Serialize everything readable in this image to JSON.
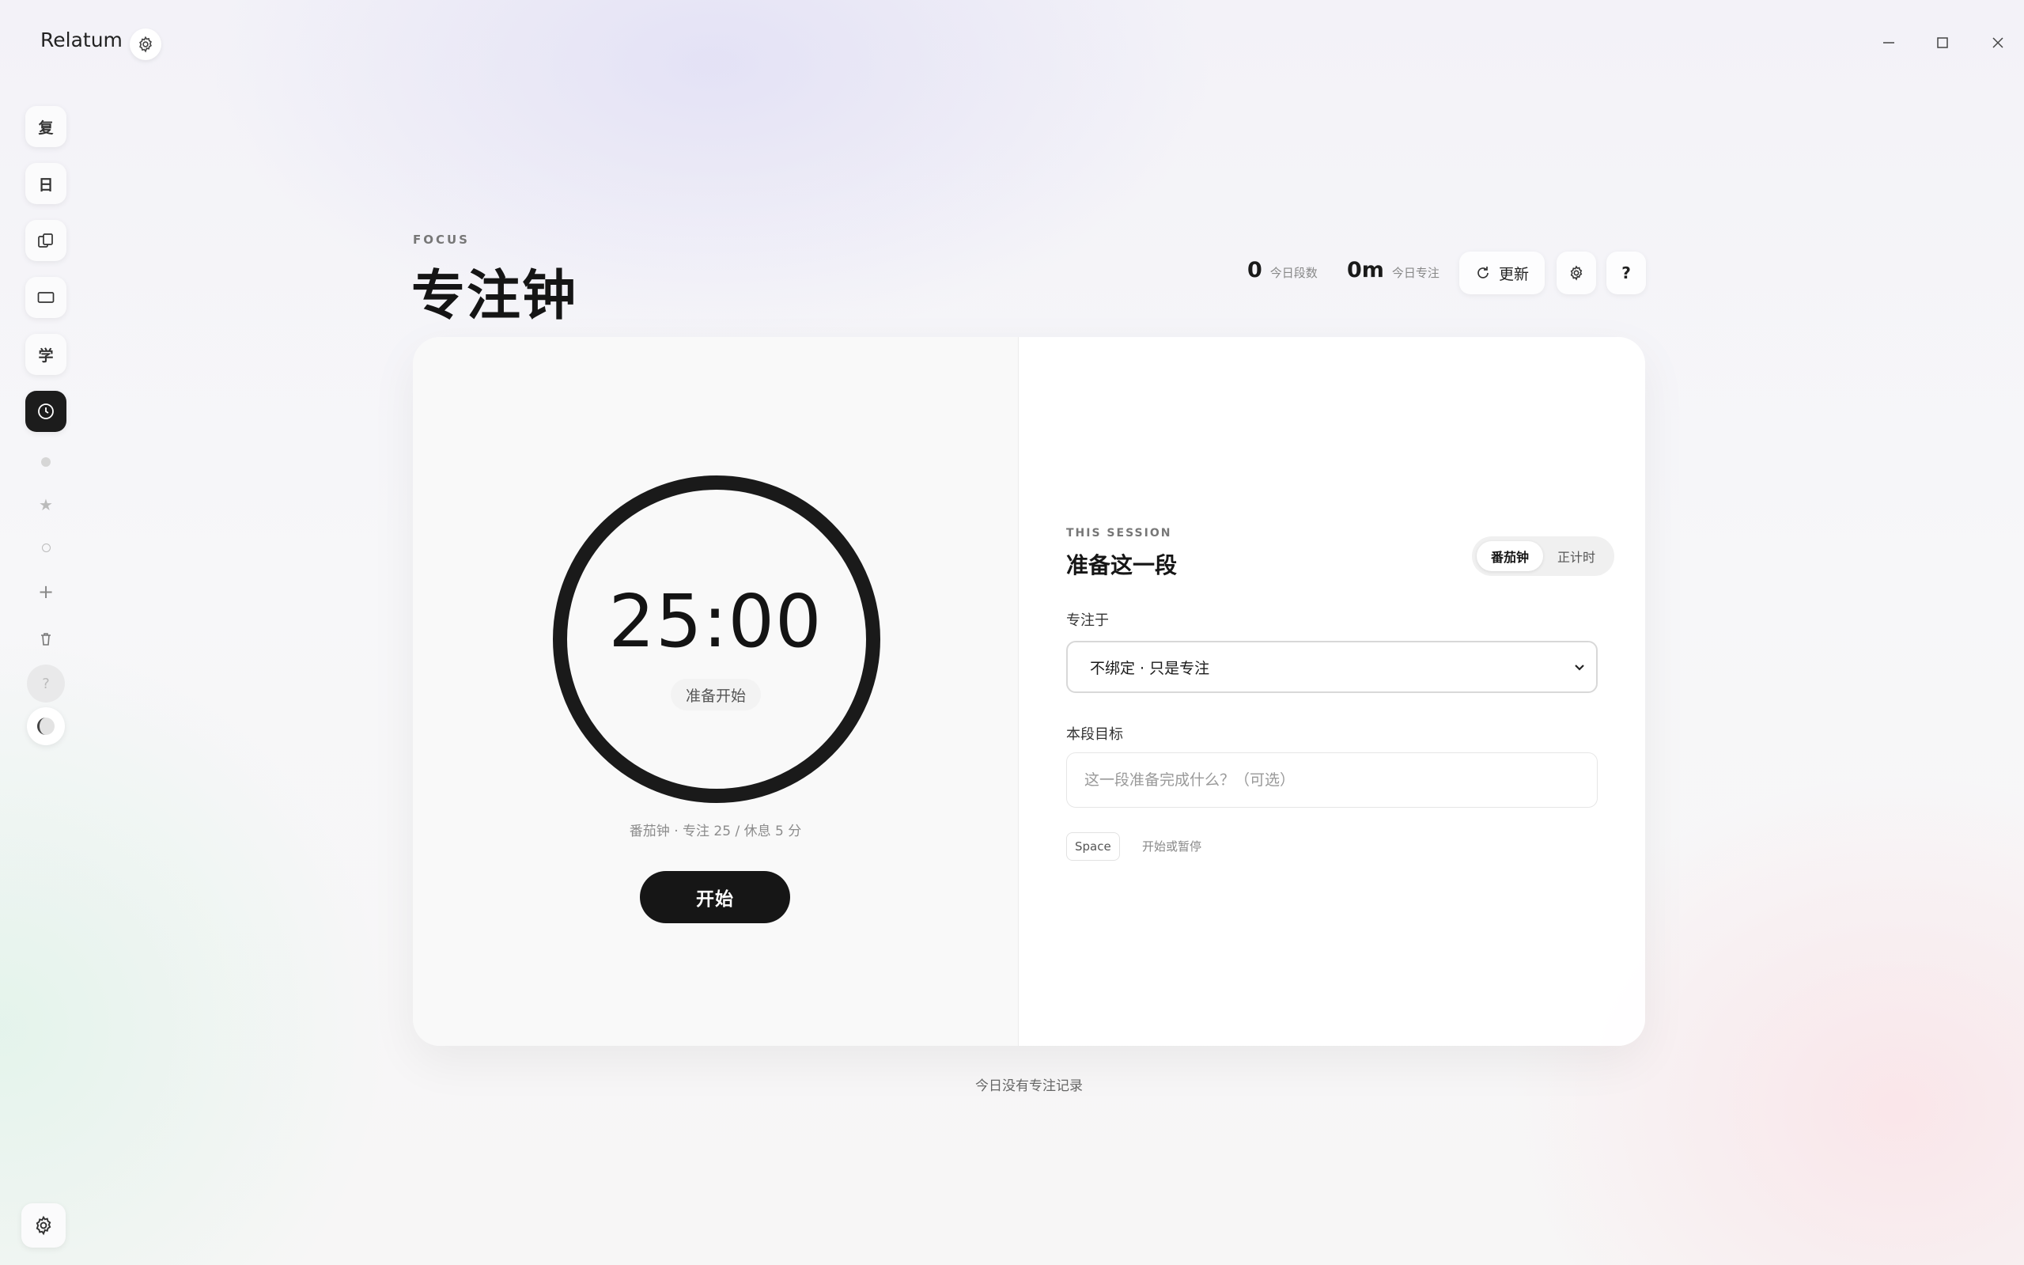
{
  "app": {
    "title": "Relatum"
  },
  "sidebar": {
    "items": [
      {
        "label": "复"
      },
      {
        "label": "日"
      },
      {
        "label": ""
      },
      {
        "label": ""
      },
      {
        "label": "学"
      },
      {
        "label": ""
      }
    ]
  },
  "header": {
    "eyebrow": "FOCUS",
    "title": "专注钟",
    "stats": [
      {
        "value": "0",
        "label": "今日段数"
      },
      {
        "value": "0m",
        "label": "今日专注"
      }
    ],
    "refresh_label": "更新",
    "help_label": "?"
  },
  "timer": {
    "time": "25:00",
    "status": "准备开始",
    "info": "番茄钟 · 专注 25 / 休息 5 分",
    "start_label": "开始"
  },
  "session": {
    "eyebrow": "THIS SESSION",
    "title": "准备这一段",
    "modes": [
      "番茄钟",
      "正计时"
    ],
    "active_mode": "番茄钟",
    "focus_label": "专注于",
    "focus_value": "不绑定 · 只是专注",
    "goal_label": "本段目标",
    "goal_placeholder": "这一段准备完成什么？（可选）",
    "shortcut_key": "Space",
    "shortcut_hint": "开始或暂停"
  },
  "footer": {
    "note": "今日没有专注记录"
  },
  "colors": {
    "accent": "#161616",
    "ring": "#1a1a1a",
    "background": "#f5f5f8"
  }
}
